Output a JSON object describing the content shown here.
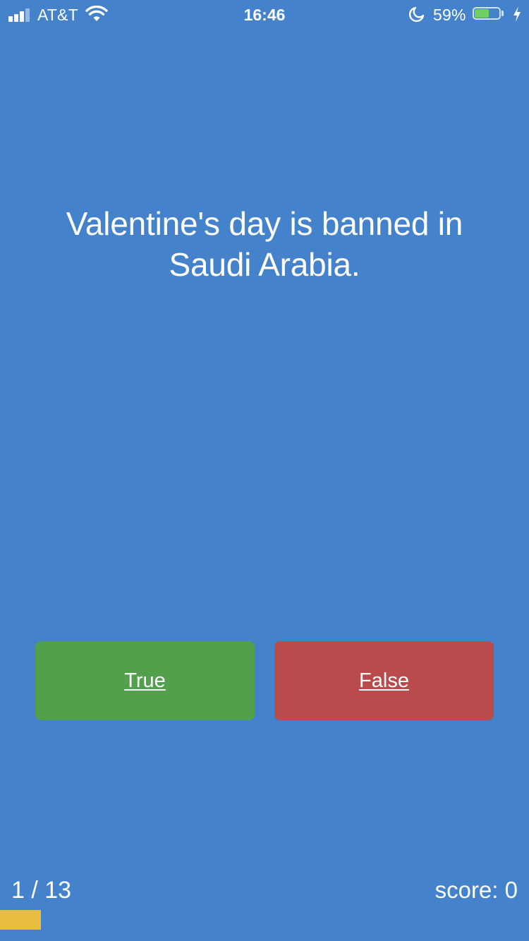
{
  "status_bar": {
    "carrier": "AT&T",
    "time": "16:46",
    "battery_percent": "59%",
    "battery_level": 0.59,
    "signal_bars_active": 3,
    "signal_bars_total": 4,
    "icons": [
      "cellular-signal-icon",
      "wifi-icon",
      "moon-icon",
      "battery-icon",
      "charging-bolt-icon"
    ]
  },
  "quiz": {
    "question": "Valentine's day is banned in Saudi Arabia.",
    "answers": {
      "true_label": "True",
      "false_label": "False"
    },
    "progress": {
      "current": 1,
      "total": 13,
      "text": "1 / 13"
    },
    "score": {
      "label": "score:",
      "value": "0"
    }
  },
  "colors": {
    "background": "#4482CB",
    "true_button": "#52A04B",
    "false_button": "#BA4B4C",
    "progress_fill": "#E7BE3F",
    "battery_fill": "#6DD060",
    "text": "#FFFFFF"
  }
}
